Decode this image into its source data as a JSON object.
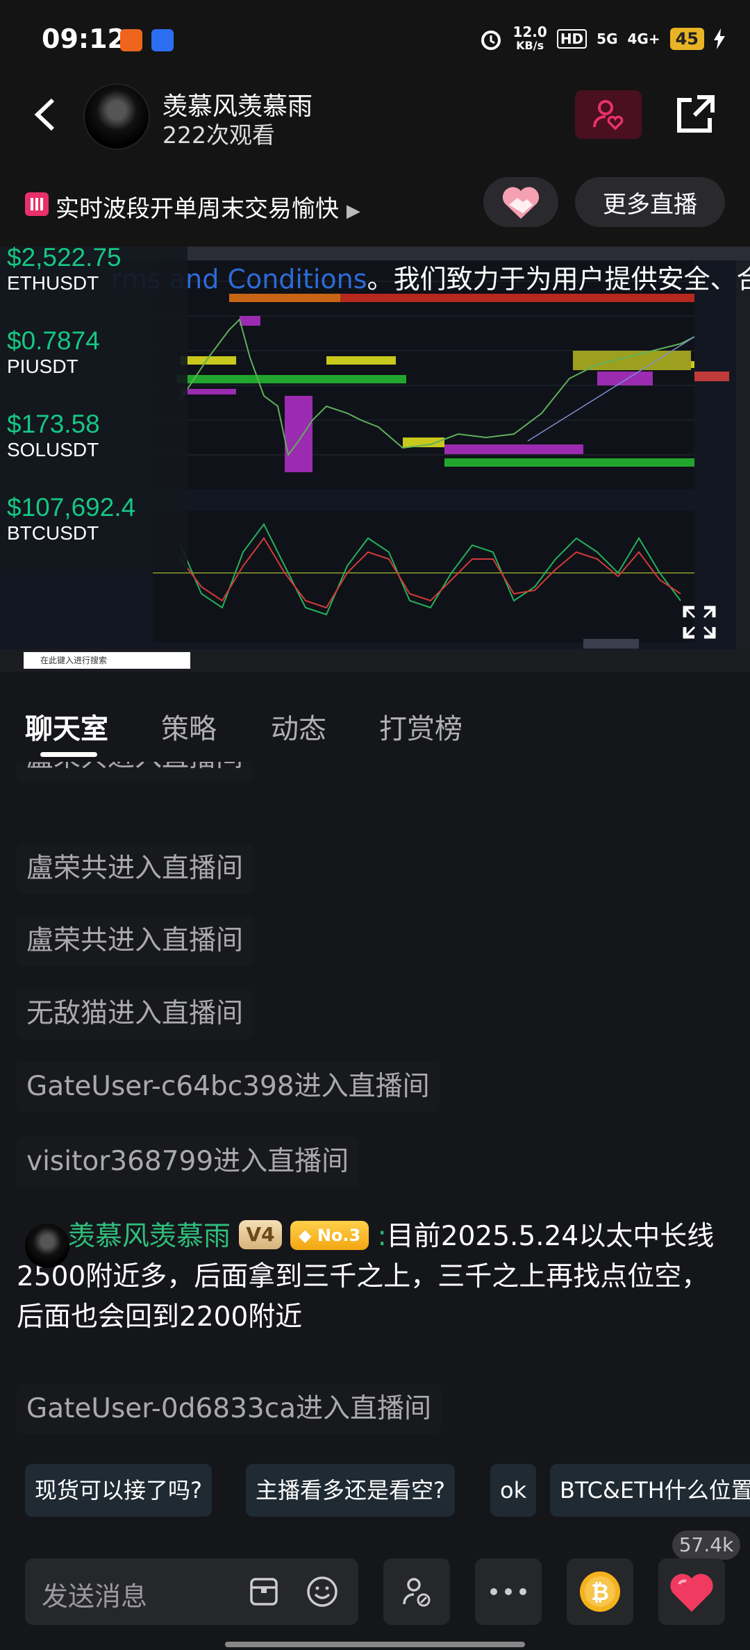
{
  "status": {
    "time": "09:12",
    "net_speed_value": "12.0",
    "net_speed_unit": "KB/s",
    "hd": "HD",
    "signal1": "5G",
    "signal2": "4G+",
    "battery": "45"
  },
  "header": {
    "host_name": "羡慕风羡慕雨",
    "views": "222次观看"
  },
  "live": {
    "title": "实时波段开单周末交易愉快",
    "more_button": "更多直播"
  },
  "video": {
    "marquee_blue": "rms and Conditions",
    "marquee_white": "。我们致力于为用户提供安全、合规的",
    "tickers": [
      {
        "price": "$2,522.75",
        "pair": "ETHUSDT"
      },
      {
        "price": "$0.7874",
        "pair": "PIUSDT"
      },
      {
        "price": "$173.58",
        "pair": "SOLUSDT"
      },
      {
        "price": "$107,692.4",
        "pair": "BTCUSDT"
      }
    ],
    "taskbar_search": "在此键入进行搜索"
  },
  "tabs": [
    "聊天室",
    "策略",
    "动态",
    "打赏榜"
  ],
  "chat": {
    "system_messages": [
      "盧荣共进入直播间",
      "盧荣共进入直播间",
      "盧荣共进入直播间",
      "无敌猫进入直播间",
      "GateUser-c64bc398进入直播间",
      "visitor368799进入直播间",
      "GateUser-0d6833ca进入直播间"
    ],
    "host_message": {
      "name": "羡慕风羡慕雨",
      "badge_level": "V4",
      "badge_rank": "No.3",
      "separator": ":",
      "text": "目前2025.5.24以太中长线2500附近多，后面拿到三千之上，三千之上再找点位空，后面也会回到2200附近"
    }
  },
  "quick_replies": [
    "现货可以接了吗?",
    "主播看多还是看空?",
    "ok",
    "BTC&ETH什么位置"
  ],
  "like_count": "57.4k",
  "input": {
    "placeholder": "发送消息"
  },
  "colors": {
    "accent_green": "#2fbf7c",
    "price_green": "#16c784",
    "like_red": "#e8316b"
  }
}
